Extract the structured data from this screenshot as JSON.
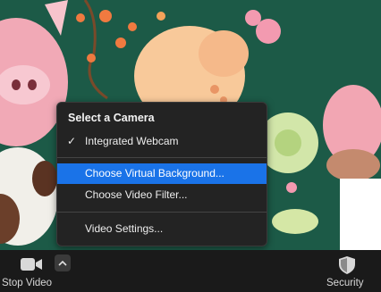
{
  "menu": {
    "header": "Select a Camera",
    "items": [
      {
        "label": "Integrated Webcam",
        "checked": true
      },
      {
        "label": "Choose Virtual Background...",
        "selected": true
      },
      {
        "label": "Choose Video Filter..."
      },
      {
        "label": "Video Settings..."
      }
    ]
  },
  "toolbar": {
    "stop_video_label": "Stop Video",
    "security_label": "Security"
  },
  "icons": {
    "check": "✓",
    "camera": "video-camera-icon",
    "caret": "chevron-up-icon",
    "shield": "shield-icon"
  },
  "colors": {
    "accent": "#1a73e8",
    "menu_bg": "#232323",
    "toolbar_bg": "#1a1a1a"
  }
}
